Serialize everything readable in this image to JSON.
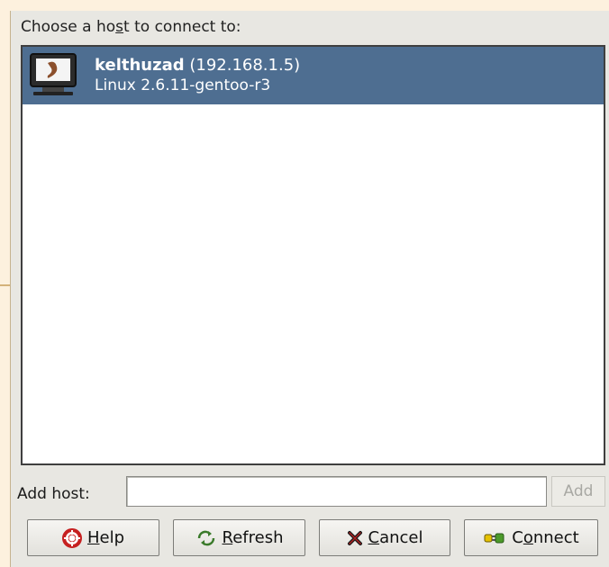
{
  "dialog": {
    "prompt_pre": "Choose a ho",
    "prompt_mnemonic": "s",
    "prompt_post": "t to connect to:"
  },
  "hosts": [
    {
      "name": "kelthuzad",
      "address": "(192.168.1.5)",
      "os": "Linux 2.6.11-gentoo-r3",
      "selected": true,
      "icon": "monitor-gentoo-icon"
    }
  ],
  "add_host": {
    "label": "Add host:",
    "value": "",
    "button_label": "Add"
  },
  "buttons": {
    "help": {
      "mnemonic": "H",
      "rest": "elp",
      "icon": "help-lifebuoy-icon"
    },
    "refresh": {
      "mnemonic": "R",
      "rest": "efresh",
      "icon": "refresh-icon"
    },
    "cancel": {
      "mnemonic": "C",
      "rest": "ancel",
      "icon": "cancel-x-icon"
    },
    "connect": {
      "pre": "C",
      "mnemonic": "o",
      "post": "nnect",
      "icon": "connect-plug-icon"
    }
  },
  "colors": {
    "selection": "#4e6e91",
    "background": "#fdf1de",
    "dialog": "#e8e7e2"
  }
}
